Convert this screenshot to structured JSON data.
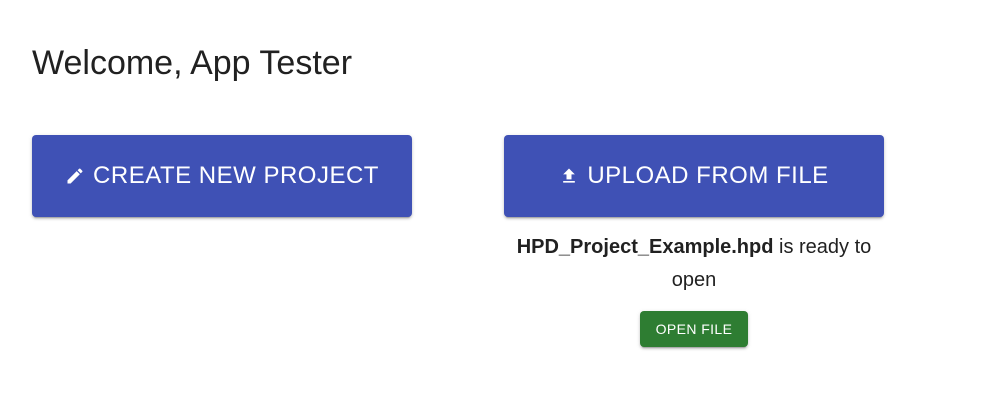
{
  "header": {
    "welcome_text": "Welcome, App Tester"
  },
  "actions": {
    "create_label": "CREATE NEW PROJECT",
    "create_icon": "pencil-icon",
    "upload_label": "UPLOAD FROM FILE",
    "upload_icon": "upload-icon"
  },
  "upload_status": {
    "file_name": "HPD_Project_Example.hpd",
    "message": " is ready to open",
    "open_label": "OPEN FILE"
  },
  "colors": {
    "primary": "#3f51b5",
    "success": "#2e7d32",
    "text": "#212121"
  }
}
